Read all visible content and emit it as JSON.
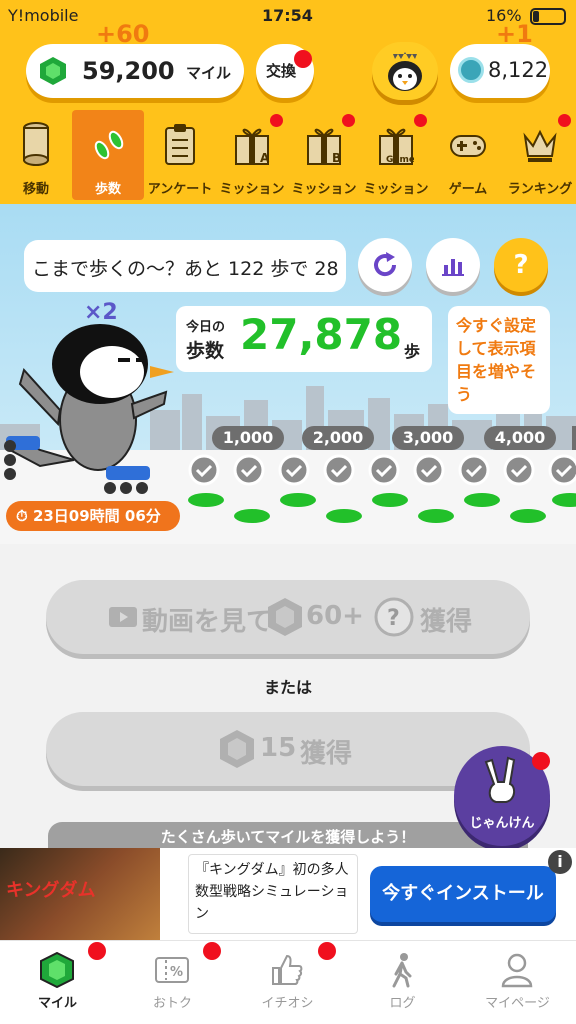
{
  "status_bar": {
    "carrier": "Y!mobile",
    "time": "17:54",
    "battery": "16%"
  },
  "header": {
    "miles_value": "59,200",
    "miles_unit": "マイル",
    "miles_gain": "+60",
    "exchange_label": "交換",
    "coin_value": "8,122",
    "coin_gain": "+1"
  },
  "tabs": [
    {
      "label": "移動",
      "icon": "cylinder-icon"
    },
    {
      "label": "歩数",
      "icon": "footprints-icon"
    },
    {
      "label": "アンケート",
      "icon": "clipboard-icon"
    },
    {
      "label": "ミッション",
      "icon": "gift-a-icon",
      "badge": "A"
    },
    {
      "label": "ミッション",
      "icon": "gift-b-icon",
      "badge": "B"
    },
    {
      "label": "ミッション",
      "icon": "gift-game-icon",
      "badge": "Game"
    },
    {
      "label": "ゲーム",
      "icon": "gamepad-icon"
    },
    {
      "label": "ランキング",
      "icon": "crown-icon"
    }
  ],
  "walk": {
    "speech": "こまで歩くの〜？あと 122 歩で 28,",
    "multiplier": "×2",
    "today_label": "今日の",
    "steps_label": "歩数",
    "steps_value": "27,878",
    "steps_unit": "歩",
    "hint": "今すぐ設定して表示項目を増やそう",
    "milestones": [
      "1,000",
      "2,000",
      "3,000",
      "4,000"
    ],
    "timer": "23日09時間 06分",
    "help_glyph": "?"
  },
  "actions": {
    "video_label": "動画を見て",
    "video_amount": "60+",
    "video_suffix": "獲得",
    "or_label": "または",
    "gem_amount": "15",
    "gem_suffix": "獲得",
    "janken_label": "じゃんけん",
    "banner": "たくさん歩いてマイルを獲得しよう！"
  },
  "ad": {
    "logo": "キングダム",
    "text": "『キングダム』初の多人数型戦略シミュレーション",
    "install": "今すぐインストール",
    "info": "i"
  },
  "bottom_nav": [
    {
      "label": "マイル",
      "icon": "gem-icon",
      "active": true
    },
    {
      "label": "おトク",
      "icon": "coupon-icon"
    },
    {
      "label": "イチオシ",
      "icon": "thumbs-up-icon"
    },
    {
      "label": "ログ",
      "icon": "walker-icon"
    },
    {
      "label": "マイページ",
      "icon": "person-icon"
    }
  ],
  "colors": {
    "header": "#ffc21a",
    "accent": "#f28418",
    "steps": "#22c02a",
    "badge": "#f0101e"
  }
}
